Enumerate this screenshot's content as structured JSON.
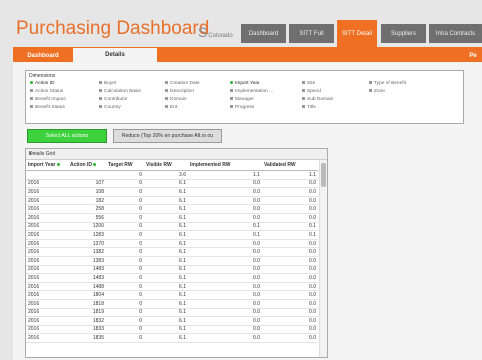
{
  "app": {
    "title": "Purchasing Dashboard",
    "logo_text": "Colorado"
  },
  "tabs": [
    {
      "label": "Dashboard",
      "active": false
    },
    {
      "label": "SITT Full",
      "active": false
    },
    {
      "label": "SITT Detail",
      "active": true
    },
    {
      "label": "Suppliers",
      "active": false
    },
    {
      "label": "Intra Contracts",
      "active": false
    }
  ],
  "subtabs": [
    {
      "label": "Dashboard",
      "active": false
    },
    {
      "label": "Details",
      "active": true
    },
    {
      "label": "Pe",
      "active": false
    }
  ],
  "dimensions": {
    "title": "Dimensions",
    "items": [
      {
        "label": "Action ID",
        "selected": true
      },
      {
        "label": "Action Status",
        "selected": false
      },
      {
        "label": "Benefit Impact",
        "selected": false
      },
      {
        "label": "Benefit Status",
        "selected": false
      },
      {
        "label": "Buyer",
        "selected": false
      },
      {
        "label": "Calculation Basis",
        "selected": false
      },
      {
        "label": "Contributor",
        "selected": false
      },
      {
        "label": "Country",
        "selected": false
      },
      {
        "label": "Creation Date",
        "selected": false
      },
      {
        "label": "Description",
        "selected": false
      },
      {
        "label": "Domain",
        "selected": false
      },
      {
        "label": "Ent",
        "selected": false
      },
      {
        "label": "Import Year",
        "selected": true
      },
      {
        "label": "Implementation ...",
        "selected": false
      },
      {
        "label": "Manager",
        "selected": false
      },
      {
        "label": "Progress",
        "selected": false
      },
      {
        "label": "Site",
        "selected": false
      },
      {
        "label": "Spend",
        "selected": false
      },
      {
        "label": "Sub Domain",
        "selected": false
      },
      {
        "label": "Title",
        "selected": false
      },
      {
        "label": "Type of Benefit",
        "selected": false
      },
      {
        "label": "Zone",
        "selected": false
      }
    ]
  },
  "buttons": {
    "select_all": "Select ALL actions",
    "reduce": "Reduce (Top 20% en purchase Alt.rs ou"
  },
  "table": {
    "caption": "Details Grid",
    "columns": [
      "Import Year",
      "Action ID",
      "Target RW",
      "Visible RW",
      "Implemented RW",
      "Validated RW"
    ],
    "totals": [
      "",
      "",
      "0",
      "3.6",
      "1.1",
      "1.1"
    ],
    "rows": [
      [
        "2016",
        "107",
        "0",
        "6.1",
        "0.0",
        "0.0"
      ],
      [
        "2016",
        "108",
        "0",
        "6.1",
        "0.0",
        "0.0"
      ],
      [
        "2016",
        "182",
        "0",
        "6.1",
        "0.0",
        "0.0"
      ],
      [
        "2016",
        "258",
        "0",
        "6.1",
        "0.0",
        "0.0"
      ],
      [
        "2016",
        "556",
        "0",
        "6.1",
        "0.0",
        "0.0"
      ],
      [
        "2016",
        "1200",
        "0",
        "6.1",
        "0.1",
        "0.1"
      ],
      [
        "2016",
        "1283",
        "0",
        "6.1",
        "0.1",
        "0.1"
      ],
      [
        "2016",
        "1370",
        "0",
        "6.1",
        "0.0",
        "0.0"
      ],
      [
        "2016",
        "1382",
        "0",
        "6.1",
        "0.0",
        "0.0"
      ],
      [
        "2016",
        "1383",
        "0",
        "6.1",
        "0.0",
        "0.0"
      ],
      [
        "2016",
        "1483",
        "0",
        "6.1",
        "0.0",
        "0.0"
      ],
      [
        "2016",
        "1483",
        "0",
        "6.1",
        "0.0",
        "0.0"
      ],
      [
        "2016",
        "1488",
        "0",
        "6.1",
        "0.0",
        "0.0"
      ],
      [
        "2016",
        "1804",
        "0",
        "6.1",
        "0.0",
        "0.0"
      ],
      [
        "2016",
        "1818",
        "0",
        "6.1",
        "0.0",
        "0.0"
      ],
      [
        "2016",
        "1819",
        "0",
        "6.1",
        "0.0",
        "0.0"
      ],
      [
        "2016",
        "1832",
        "0",
        "6.1",
        "0.0",
        "0.0"
      ],
      [
        "2016",
        "1833",
        "0",
        "6.1",
        "0.0",
        "0.0"
      ],
      [
        "2016",
        "1835",
        "0",
        "6.1",
        "0.0",
        "0.0"
      ]
    ]
  },
  "colors": {
    "accent": "#ef7023",
    "tab_inactive": "#6f6f6f",
    "select_green": "#3ed13e"
  }
}
